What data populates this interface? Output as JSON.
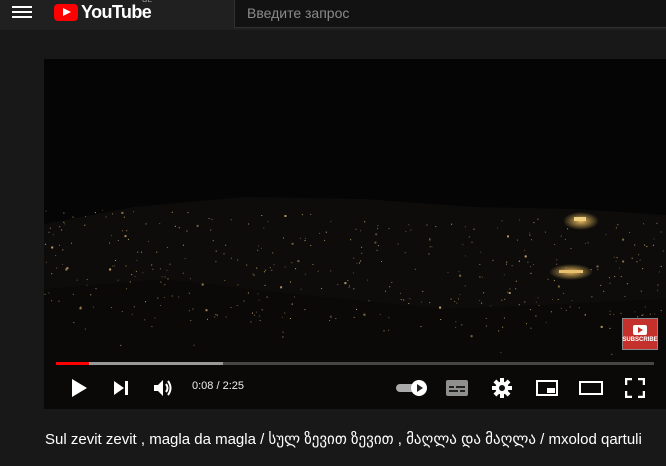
{
  "header": {
    "logo_text": "YouTube",
    "country_code": "GE",
    "search_placeholder": "Введите запрос"
  },
  "player": {
    "current_time": "0:08",
    "duration": "2:25",
    "time_display": "0:08 / 2:25",
    "progress_fraction": 0.055,
    "buffered_fraction": 0.28,
    "subscribe_badge_text": "SUBSCRIBE",
    "icons": [
      "play-icon",
      "next-icon",
      "volume-icon",
      "autoplay-toggle-icon",
      "subtitles-icon",
      "settings-icon",
      "miniplayer-icon",
      "theater-icon",
      "fullscreen-icon"
    ]
  },
  "video": {
    "title": "Sul zevit zevit , magla da magla / სულ ზევით ზევით , მაღლა და მაღლა / mxolod qartuli"
  },
  "colors": {
    "accent": "#ff0000",
    "background": "#181818",
    "header": "#202020"
  }
}
